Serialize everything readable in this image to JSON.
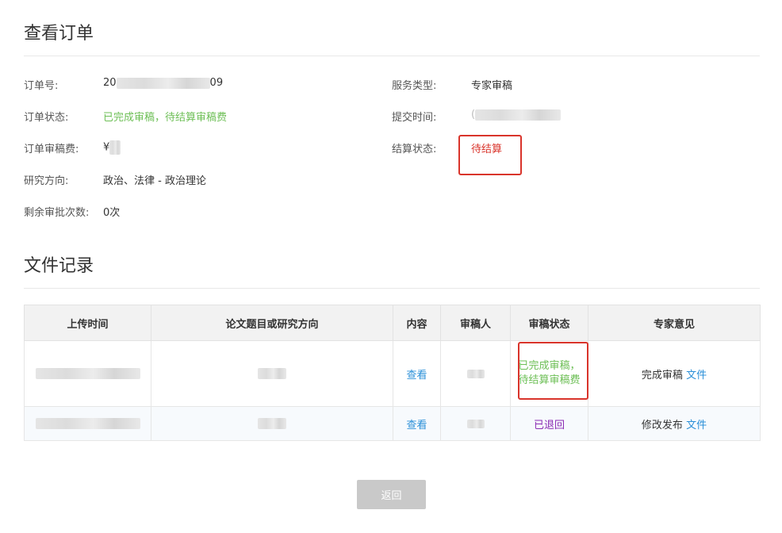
{
  "order_section": {
    "title": "查看订单",
    "order_no": {
      "label": "订单号:",
      "prefix": "20",
      "suffix": "09"
    },
    "service_type": {
      "label": "服务类型:",
      "value": "专家审稿"
    },
    "order_status": {
      "label": "订单状态:",
      "value": "已完成审稿，待结算审稿费"
    },
    "submit_time": {
      "label": "提交时间:",
      "prefix": "("
    },
    "review_fee": {
      "label": "订单审稿费:",
      "prefix": "¥"
    },
    "settle_status": {
      "label": "结算状态:",
      "value": "待结算"
    },
    "research_dir": {
      "label": "研究方向:",
      "value": "政治、法律 - 政治理论"
    },
    "remaining": {
      "label": "剩余审批次数:",
      "value": "0次"
    }
  },
  "files_section": {
    "title": "文件记录",
    "columns": [
      "上传时间",
      "论文题目或研究方向",
      "内容",
      "审稿人",
      "审稿状态",
      "专家意见"
    ],
    "rows": [
      {
        "content_link": "查看",
        "status": "已完成审稿，待结算审稿费",
        "opinion_text": "完成审稿",
        "opinion_link": "文件"
      },
      {
        "content_link": "查看",
        "status": "已退回",
        "opinion_text": "修改发布",
        "opinion_link": "文件"
      }
    ]
  },
  "back_button": "返回",
  "colors": {
    "green": "#6dbf56",
    "red": "#d9342b",
    "purple": "#8a2ab3",
    "link": "#2a8fd8",
    "button": "#c9c9c9"
  }
}
